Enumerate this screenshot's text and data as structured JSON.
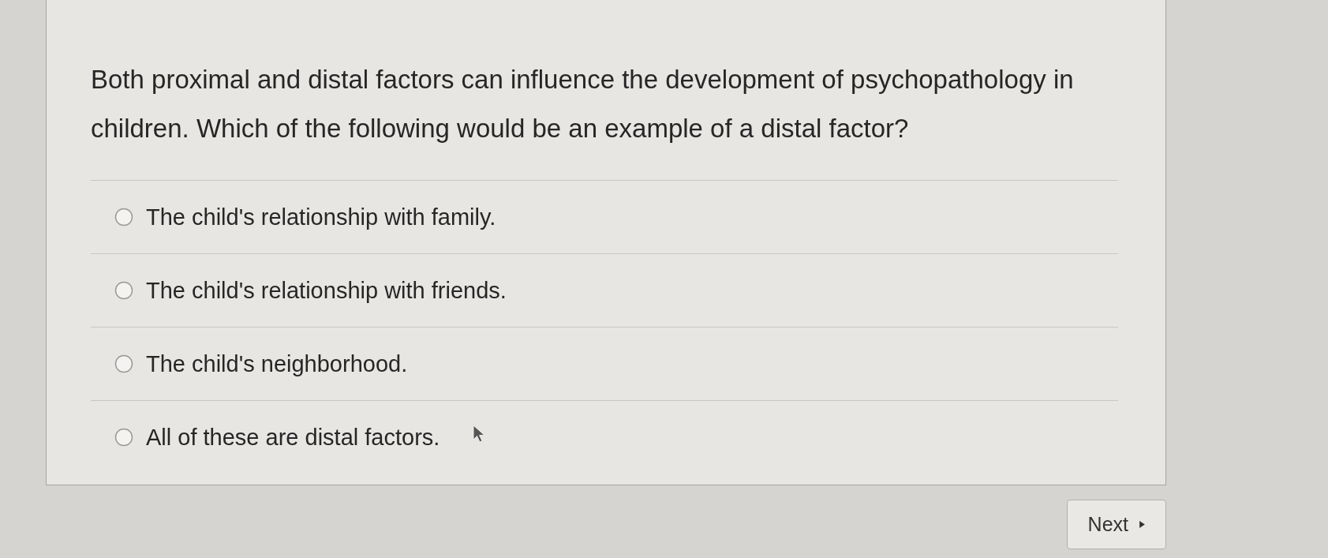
{
  "question": {
    "text": "Both proximal and distal factors can influence the development of psychopathology in children. Which of the following would be an example of a distal factor?"
  },
  "options": [
    {
      "label": "The child's relationship with family.",
      "selected": false
    },
    {
      "label": "The child's relationship with friends.",
      "selected": false
    },
    {
      "label": "The child's neighborhood.",
      "selected": false
    },
    {
      "label": "All of these are distal factors.",
      "selected": false
    }
  ],
  "next_button": {
    "label": "Next"
  }
}
